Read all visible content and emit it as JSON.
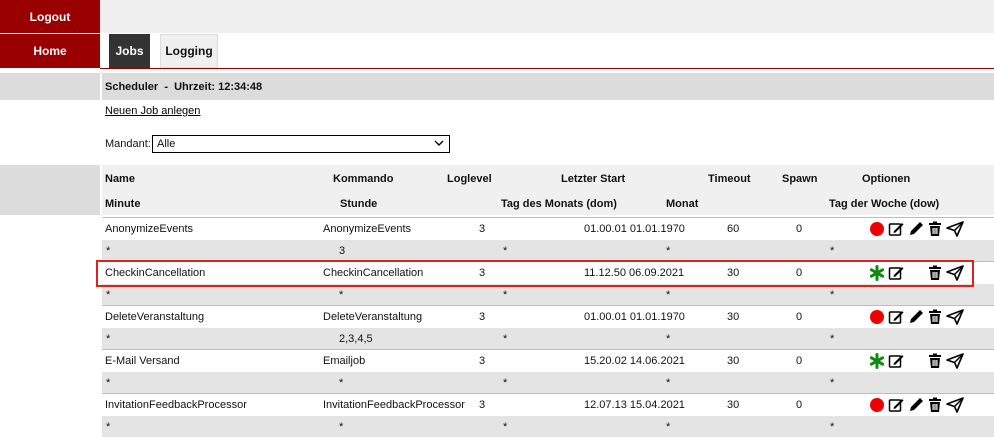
{
  "nav": {
    "logout_label": "Logout",
    "home_label": "Home"
  },
  "tabs": {
    "jobs_label": "Jobs",
    "logging_label": "Logging"
  },
  "scheduler": {
    "title": "Scheduler",
    "separator": "-",
    "time_label": "Uhrzeit:",
    "time_value": "12:34:48"
  },
  "new_job_link": "Neuen Job anlegen",
  "mandant": {
    "label": "Mandant:",
    "selected": "Alle"
  },
  "columns": {
    "name": "Name",
    "kommando": "Kommando",
    "loglevel": "Loglevel",
    "letzter_start": "Letzter Start",
    "timeout": "Timeout",
    "spawn": "Spawn",
    "optionen": "Optionen",
    "minute": "Minute",
    "stunde": "Stunde",
    "tag_des_monats": "Tag des Monats (dom)",
    "monat": "Monat",
    "tag_der_woche": "Tag der Woche (dow)"
  },
  "jobs": [
    {
      "name": "AnonymizeEvents",
      "kommando": "AnonymizeEvents",
      "loglevel": "3",
      "letzter_start": "01.00.01 01.01.1970",
      "timeout": "60",
      "spawn": "0",
      "minute": "*",
      "stunde": "3",
      "dom": "*",
      "monat": "*",
      "dow": "*",
      "status_icon": "red-dot-icon"
    },
    {
      "name": "CheckinCancellation",
      "kommando": "CheckinCancellation",
      "loglevel": "3",
      "letzter_start": "11.12.50 06.09.2021",
      "timeout": "30",
      "spawn": "0",
      "minute": "*",
      "stunde": "*",
      "dom": "*",
      "monat": "*",
      "dow": "*",
      "status_icon": "green-asterisk-icon"
    },
    {
      "name": "DeleteVeranstaltung",
      "kommando": "DeleteVeranstaltung",
      "loglevel": "3",
      "letzter_start": "01.00.01 01.01.1970",
      "timeout": "30",
      "spawn": "0",
      "minute": "*",
      "stunde": "2,3,4,5",
      "dom": "*",
      "monat": "*",
      "dow": "*",
      "status_icon": "red-dot-icon"
    },
    {
      "name": "E-Mail Versand",
      "kommando": "Emailjob",
      "loglevel": "3",
      "letzter_start": "15.20.02 14.06.2021",
      "timeout": "30",
      "spawn": "0",
      "minute": "*",
      "stunde": "*",
      "dom": "*",
      "monat": "*",
      "dow": "*",
      "status_icon": "green-asterisk-icon"
    },
    {
      "name": "InvitationFeedbackProcessor",
      "kommando": "InvitationFeedbackProcessor",
      "loglevel": "3",
      "letzter_start": "12.07.13 15.04.2021",
      "timeout": "30",
      "spawn": "0",
      "minute": "*",
      "stunde": "*",
      "dom": "*",
      "monat": "*",
      "dow": "*",
      "status_icon": "red-dot-icon"
    }
  ],
  "colors": {
    "brand": "#990000",
    "active_tab": "#333333",
    "running": "#ee0000",
    "idle": "#118811",
    "highlight": "#dd2222"
  },
  "icons": [
    "red-dot-icon",
    "green-asterisk-icon",
    "edit-icon",
    "pencil-icon",
    "trash-icon",
    "send-icon"
  ]
}
